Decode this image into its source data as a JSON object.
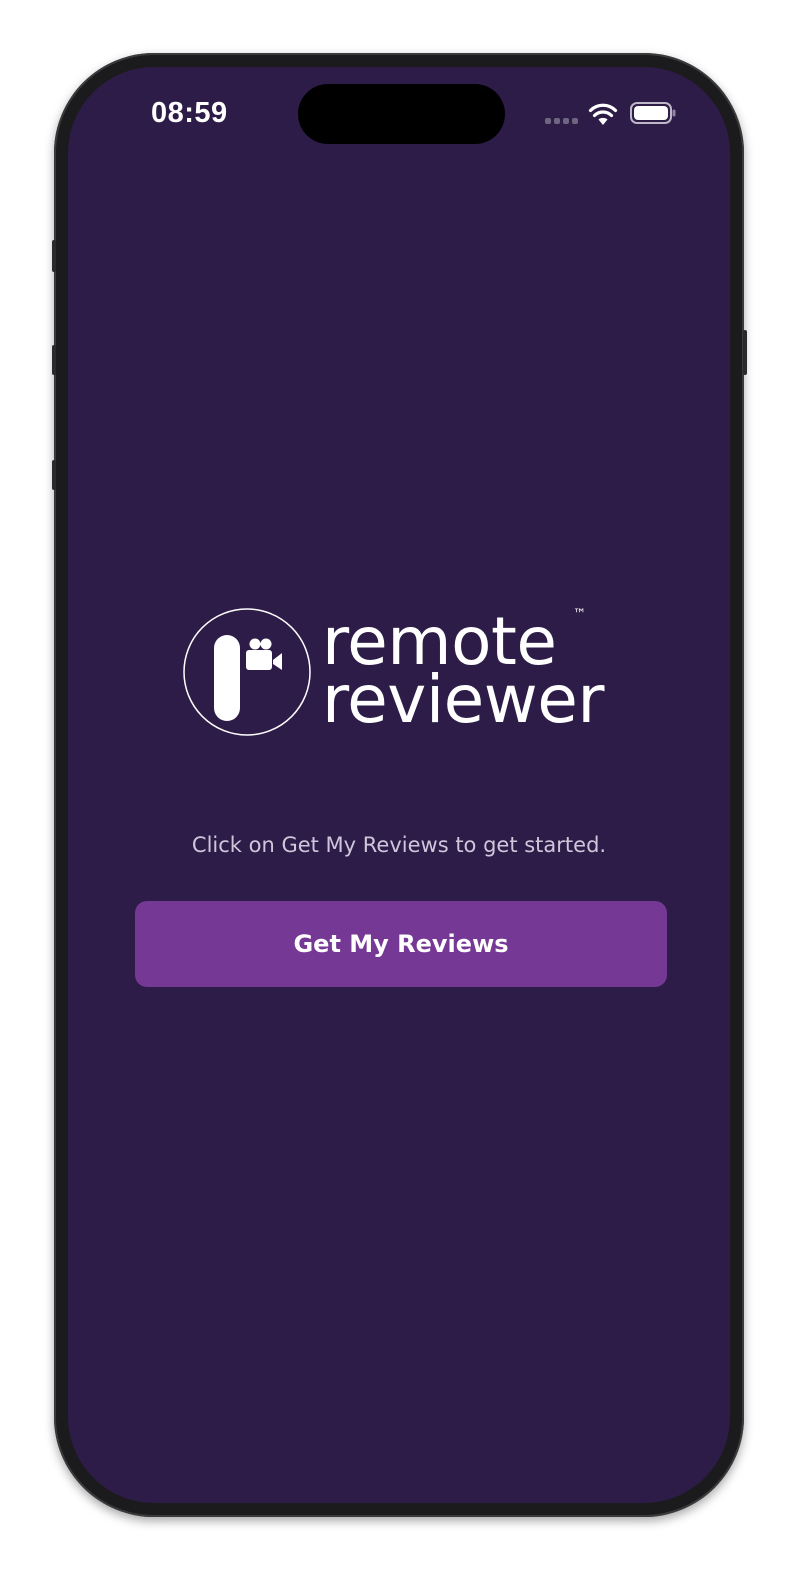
{
  "status_bar": {
    "time": "08:59",
    "icons": [
      "signal-icon",
      "wifi-icon",
      "battery-icon"
    ]
  },
  "logo": {
    "line1": "remote",
    "line2": "reviewer",
    "trademark": "™",
    "icon": "camera-icon"
  },
  "main": {
    "instruction": "Click on Get My Reviews to get started.",
    "button_label": "Get My Reviews"
  },
  "colors": {
    "background": "#2d1c47",
    "button": "#763895",
    "text": "#ffffff",
    "muted_text": "#cfc6db"
  }
}
